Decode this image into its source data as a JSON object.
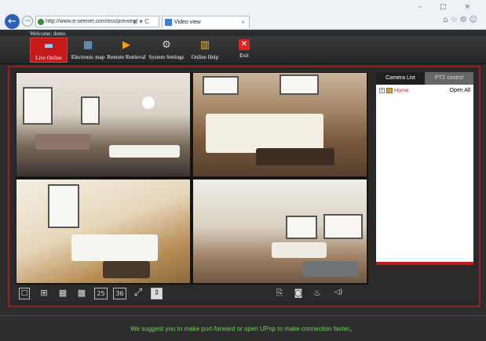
{
  "browser": {
    "back_glyph": "←",
    "forward_glyph": "→",
    "address": "http://www.e-seenet.com/ess/preview/",
    "address_icons": "ρ ▾ C",
    "tab_title": "Video view",
    "tab_close": "×",
    "window_controls": "– □ ×",
    "toolbar_icons": "⌂☆⚙☺"
  },
  "app": {
    "welcome_text": "Welcome: demo",
    "menu": [
      {
        "label": "Live Online",
        "icon": "▬",
        "active": true
      },
      {
        "label": "Electronic map",
        "icon": "▦"
      },
      {
        "label": "Remote Retrieval",
        "icon": "▶"
      },
      {
        "label": "System Settings",
        "icon": "⚙"
      },
      {
        "label": "Online Help",
        "icon": "▥"
      },
      {
        "label": "Exit",
        "icon": "✕"
      }
    ]
  },
  "controls": {
    "layout_buttons": [
      {
        "name": "layout-1-button",
        "glyph": "□"
      },
      {
        "name": "layout-4-button",
        "glyph": "⊞"
      },
      {
        "name": "layout-9-button",
        "glyph": "▦"
      },
      {
        "name": "layout-16-button",
        "glyph": "▩"
      },
      {
        "name": "layout-25-button",
        "glyph": "25"
      },
      {
        "name": "layout-36-button",
        "glyph": "36"
      }
    ],
    "fullscreen_glyph": "⤢",
    "toggle_glyph": "⇕",
    "record_glyph": "⎘",
    "snapshot_glyph": "◙",
    "talk_glyph": "♨",
    "volume_glyph": "◁)"
  },
  "side_panel": {
    "tabs": [
      "Camera List",
      "PTZ control"
    ],
    "tree_root": "Home",
    "expand_glyph": "+",
    "open_all": "Open All"
  },
  "status": {
    "message": "We suggest you to make port-forward or open UPnp to make connection faster。"
  },
  "colors": {
    "accent": "#c41a1a",
    "status_text": "#6fd15b",
    "background": "#2d2d2d"
  }
}
